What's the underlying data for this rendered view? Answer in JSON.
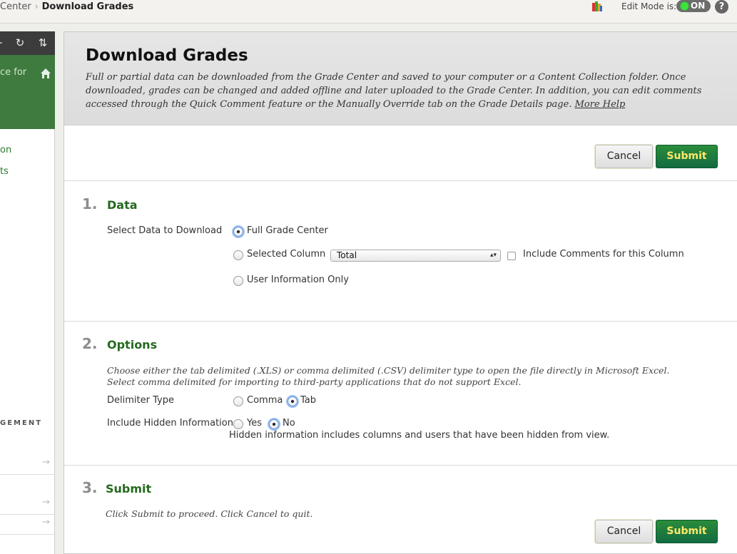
{
  "topbar": {
    "breadcrumb_prev": "Center",
    "breadcrumb_sep": "›",
    "breadcrumb_current": "Download Grades",
    "edit_mode_label": "Edit Mode is:",
    "edit_mode_state": "ON",
    "help_label": "?"
  },
  "sidebar": {
    "course_text": "ce for",
    "links": [
      "on",
      "ts"
    ],
    "management_label": "GEMENT",
    "arrow": "→"
  },
  "header": {
    "title": "Download Grades",
    "description": "Full or partial data can be downloaded from the Grade Center and saved to your computer or a Content Collection folder. Once downloaded, grades can be changed and added offline and later uploaded to the Grade Center. In addition, you can edit comments accessed through the Quick Comment feature or the Manually Override tab on the Grade Details page.",
    "more_help": "More Help"
  },
  "buttons": {
    "cancel": "Cancel",
    "submit": "Submit"
  },
  "step1": {
    "number": "1.",
    "title": "Data",
    "field_label": "Select Data to Download",
    "options": [
      "Full Grade Center",
      "Selected Column",
      "User Information Only"
    ],
    "selected_index": 0,
    "column_select_value": "Total",
    "include_comments_label": "Include Comments for this Column"
  },
  "step2": {
    "number": "2.",
    "title": "Options",
    "note": "Choose either the tab delimited (.XLS) or comma delimited (.CSV) delimiter type to open the file directly in Microsoft Excel. Select comma delimited for importing to third-party applications that do not support Excel.",
    "delimiter_label": "Delimiter Type",
    "delimiter_options": [
      "Comma",
      "Tab"
    ],
    "delimiter_selected": "Tab",
    "hidden_label": "Include Hidden Information",
    "hidden_options": [
      "Yes",
      "No"
    ],
    "hidden_selected": "No",
    "hidden_note": "Hidden information includes columns and users that have been hidden from view."
  },
  "step3": {
    "number": "3.",
    "title": "Submit",
    "note": "Click Submit to proceed. Click Cancel to quit."
  },
  "colors": {
    "accent_green": "#25691e",
    "submit_bg": "#136b43",
    "submit_text": "#ffe96b"
  }
}
